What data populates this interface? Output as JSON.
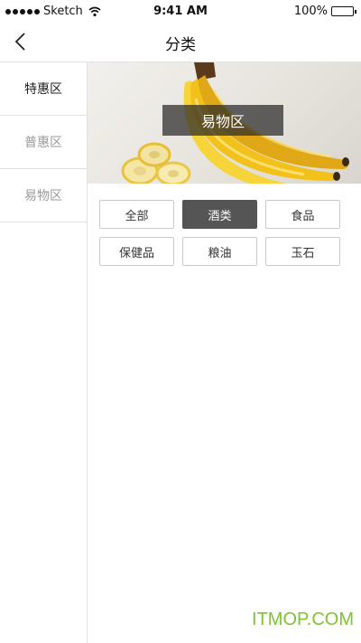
{
  "status_bar": {
    "carrier": "Sketch",
    "time": "9:41 AM",
    "battery": "100%",
    "icons": [
      "signal-dots-icon",
      "wifi-icon",
      "battery-icon"
    ]
  },
  "nav": {
    "title": "分类",
    "back_icon": "chevron-left-icon"
  },
  "sidebar": {
    "items": [
      {
        "label": "特惠区",
        "active": true
      },
      {
        "label": "普惠区",
        "active": false
      },
      {
        "label": "易物区",
        "active": false
      }
    ]
  },
  "banner": {
    "label": "易物区",
    "image": "bananas-photo"
  },
  "categories": [
    {
      "label": "全部",
      "active": false
    },
    {
      "label": "酒类",
      "active": true
    },
    {
      "label": "食品",
      "active": false
    },
    {
      "label": "保健品",
      "active": false
    },
    {
      "label": "粮油",
      "active": false
    },
    {
      "label": "玉石",
      "active": false
    }
  ],
  "watermark": "ITMOP.COM",
  "colors": {
    "active_tag_bg": "#555555",
    "divider": "#e2e2e2",
    "watermark": "#7cc52e"
  }
}
